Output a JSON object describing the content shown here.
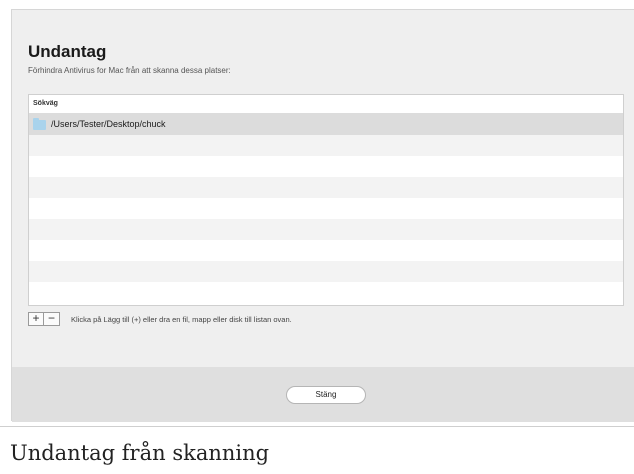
{
  "dialog": {
    "title": "Undantag",
    "subtitle": "Förhindra Antivirus for Mac från att skanna dessa platser:",
    "table": {
      "column_header": "Sökväg",
      "rows": [
        {
          "icon": "folder-icon",
          "path": "/Users/Tester/Desktop/chuck",
          "selected": true
        }
      ]
    },
    "controls": {
      "add_label": "+",
      "remove_label": "−",
      "hint": "Klicka på Lägg till (+) eller dra en fil, mapp eller disk till listan ovan."
    },
    "close_button_label": "Stäng"
  },
  "caption": "Undantag från skanning",
  "colors": {
    "window_bg": "#efefef",
    "footer_bg": "#dfdfdf",
    "selected_row": "#dcdcdc",
    "stripe_row": "#f3f3f3",
    "folder_icon": "#a9d3ec"
  }
}
